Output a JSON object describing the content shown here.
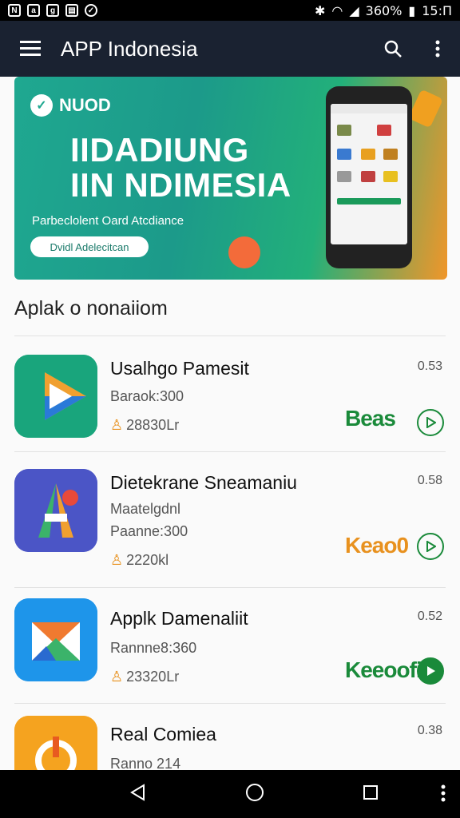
{
  "status_bar": {
    "left_icons": [
      "notification-icon",
      "app-icon",
      "app-icon",
      "app-icon",
      "check-icon"
    ],
    "battery": "360%",
    "time": "15:П"
  },
  "appbar": {
    "title": "APP Indonesia"
  },
  "banner": {
    "logo_text": "NUOD",
    "headline_line1": "IIDADIUNG",
    "headline_line2": "IIN NDIMESIA",
    "subtitle": "Parbeclolent Oard Atcdiance",
    "cta_label": "Dvidl Adelecitcan"
  },
  "section_title": "Aplak o nonaiiom",
  "apps": [
    {
      "name": "Usalhgo Pamesit",
      "line1": "Baraok:300",
      "line2": "",
      "users": "28830Lr",
      "size": "0.53",
      "badge": "Beas",
      "badge_color": "#1a8a3a"
    },
    {
      "name": "Dietekrane Sneamaniu",
      "line1": "Maatelgdnl",
      "line2": "Paanne:300",
      "users": "2220kl",
      "size": "0.58",
      "badge": "Keao0",
      "badge_color": "#e8911e"
    },
    {
      "name": "Applk Damenaliit",
      "line1": "Rannne8:360",
      "line2": "",
      "users": "23320Lr",
      "size": "0.52",
      "badge": "Keeoofi",
      "badge_color": "#1a8a3a"
    },
    {
      "name": "Real Comiea",
      "line1": "Ranno 214",
      "line2": "",
      "users": "",
      "size": "0.38",
      "badge": "",
      "badge_color": ""
    }
  ],
  "colors": {
    "appbar": "#1a2231",
    "accent_green": "#1a8a3a",
    "accent_orange": "#e8911e"
  }
}
